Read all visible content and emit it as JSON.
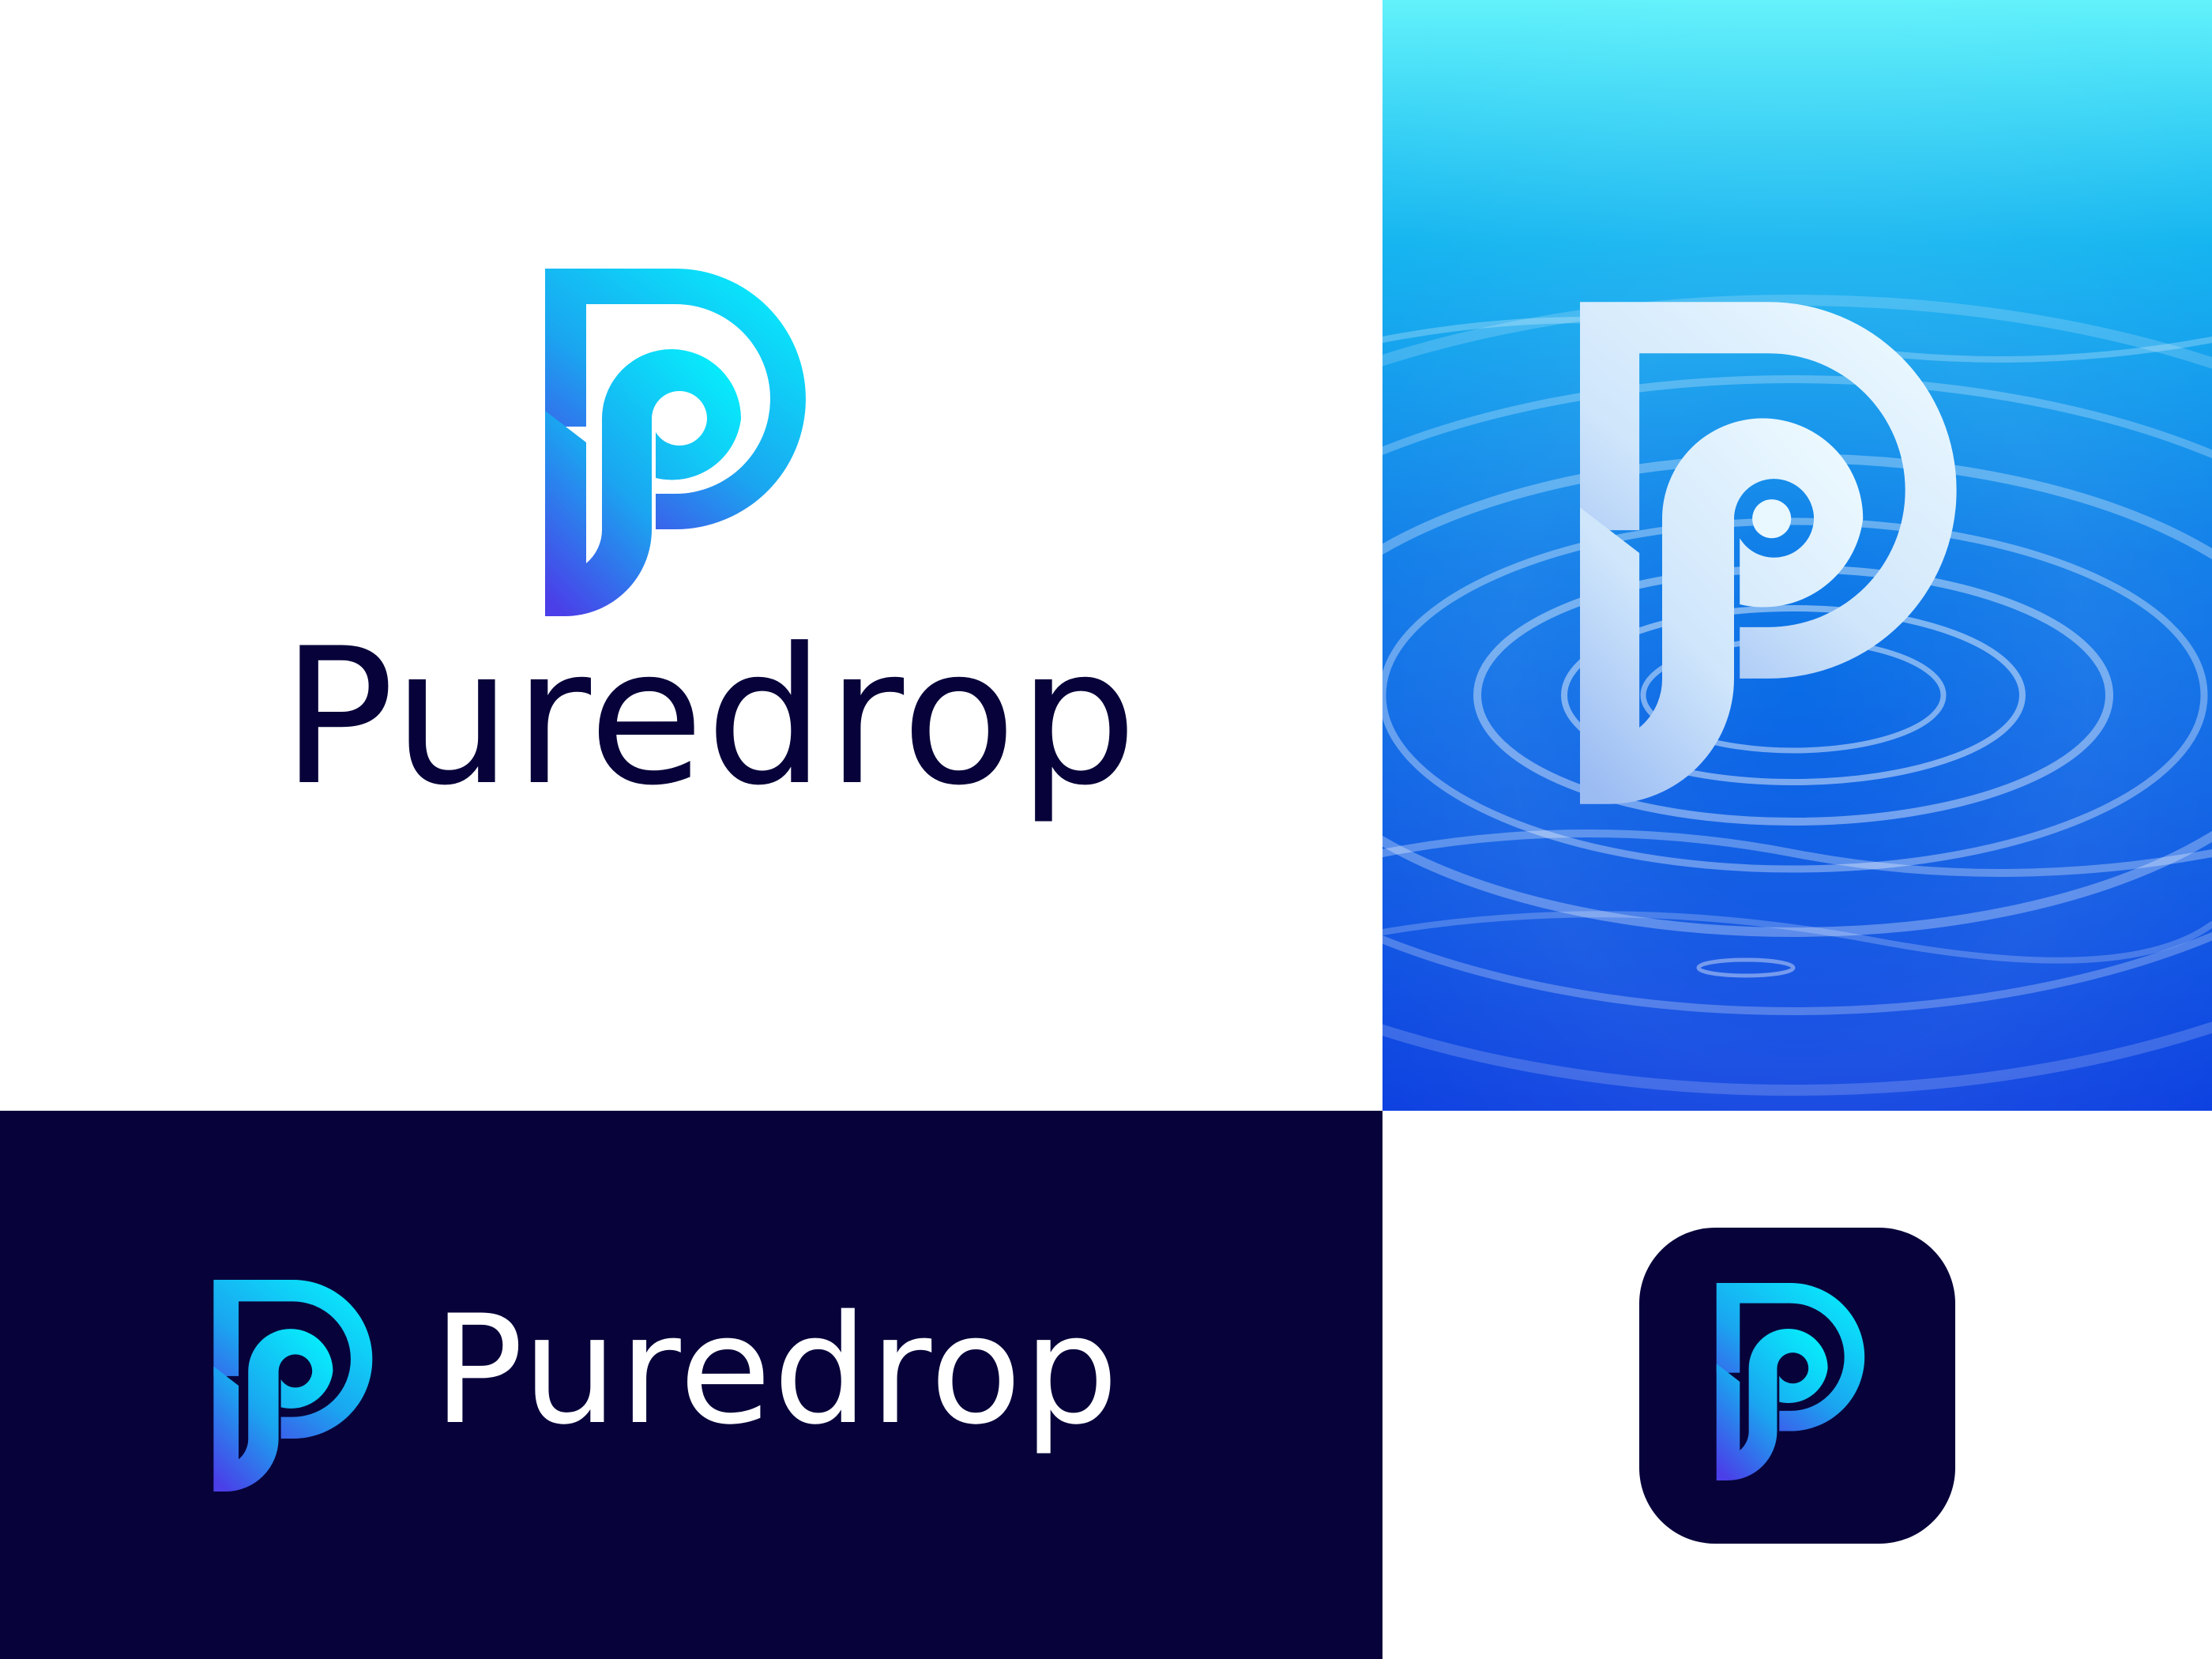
{
  "brand": {
    "name": "Puredrop"
  },
  "colors": {
    "gradient_top": "#07eefc",
    "gradient_mid": "#1aa6f0",
    "gradient_bottom": "#4a3fe8",
    "navy": "#07033a",
    "white": "#ffffff",
    "water_light": "#5ff0fb",
    "water_mid": "#0b8fe6",
    "water_deep": "#0a3fdf",
    "glass_light": "#e9f7ff",
    "glass_dark": "#8fb7f2"
  },
  "panels": {
    "top_left": {
      "background": "white",
      "icon": "puredrop-logo-icon"
    },
    "top_right": {
      "background": "water-ripple",
      "icon": "puredrop-logo-icon"
    },
    "bottom_left": {
      "background": "navy",
      "icon": "puredrop-logo-icon"
    },
    "bottom_right": {
      "background": "white",
      "icon": "app-icon"
    }
  }
}
